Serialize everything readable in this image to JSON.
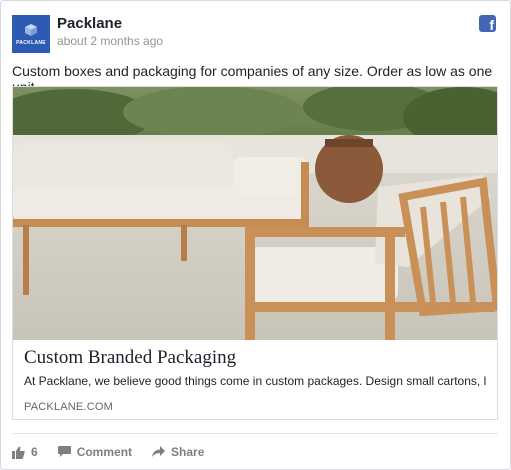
{
  "post": {
    "page_name": "Packlane",
    "timestamp": "about 2 months ago",
    "avatar_text": "PACKLANE",
    "text": "Custom boxes and packaging for companies of any size. Order as low as one unit."
  },
  "link_preview": {
    "title": "Custom Branded Packaging",
    "description": "At Packlane, we believe good things come in custom packages. Design small cartons, large pr...",
    "domain": "PACKLANE.COM"
  },
  "actions": {
    "like_count": "6",
    "comment_label": "Comment",
    "share_label": "Share"
  },
  "icons": {
    "platform": "facebook-icon",
    "like": "thumbs-up-icon",
    "comment": "speech-bubble-icon",
    "share": "share-arrow-icon"
  },
  "colors": {
    "facebook_blue": "#4267b2",
    "avatar_bg": "#2d5bb3",
    "meta_text": "#90949c",
    "action_text": "#7f7f7f"
  }
}
